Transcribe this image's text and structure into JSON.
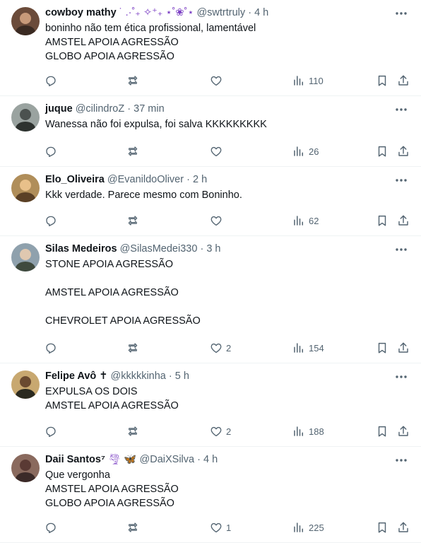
{
  "tweets": [
    {
      "name": "cowboy mathy",
      "name_suffix": " ˙ .·˚₊ ✧⁺₊ ⋆˚❀˚⋆",
      "handle": "@swtrtruly",
      "time": "4 h",
      "lines": [
        "boninho não tem ética profissional, lamentável",
        "AMSTEL APOIA AGRESSÃO",
        "GLOBO APOIA AGRESSÃO"
      ],
      "likes": "",
      "views": "110"
    },
    {
      "name": "juque",
      "name_suffix": "",
      "handle": "@cilindroZ",
      "time": "37 min",
      "lines": [
        "Wanessa não foi expulsa, foi salva KKKKKKKKK"
      ],
      "likes": "",
      "views": "26"
    },
    {
      "name": "Elo_Oliveira",
      "name_suffix": "",
      "handle": "@EvanildoOliver",
      "time": "2 h",
      "lines": [
        "Kkk verdade. Parece mesmo com Boninho."
      ],
      "likes": "",
      "views": "62"
    },
    {
      "name": "Silas Medeiros",
      "name_suffix": "",
      "handle": "@SilasMedei330",
      "time": "3 h",
      "lines": [
        "STONE APOIA AGRESSÃO",
        "",
        "AMSTEL APOIA AGRESSÃO",
        "",
        "CHEVROLET APOIA AGRESSÃO"
      ],
      "likes": "2",
      "views": "154"
    },
    {
      "name": "Felipe Avô ✝",
      "name_suffix": "",
      "handle": "@kkkkkinha",
      "time": "5 h",
      "lines": [
        "EXPULSA OS DOIS",
        "AMSTEL APOIA AGRESSÃO"
      ],
      "likes": "2",
      "views": "188"
    },
    {
      "name": "Daii Santos⁷",
      "name_suffix": " 🌪 🦋",
      "handle": "@DaiXSilva",
      "time": "4 h",
      "lines": [
        "Que vergonha",
        "AMSTEL APOIA AGRESSÃO",
        "GLOBO APOIA AGRESSÃO"
      ],
      "likes": "1",
      "views": "225"
    }
  ],
  "separator": "·",
  "icons": {
    "reply": "reply-icon",
    "retweet": "retweet-icon",
    "like": "heart-icon",
    "views": "views-icon",
    "bookmark": "bookmark-icon",
    "share": "share-icon",
    "more": "more-icon"
  },
  "colors": {
    "text": "#0f1419",
    "secondary": "#536471",
    "border": "#eff3f4",
    "emoji_purple": "#7b3fc4"
  }
}
